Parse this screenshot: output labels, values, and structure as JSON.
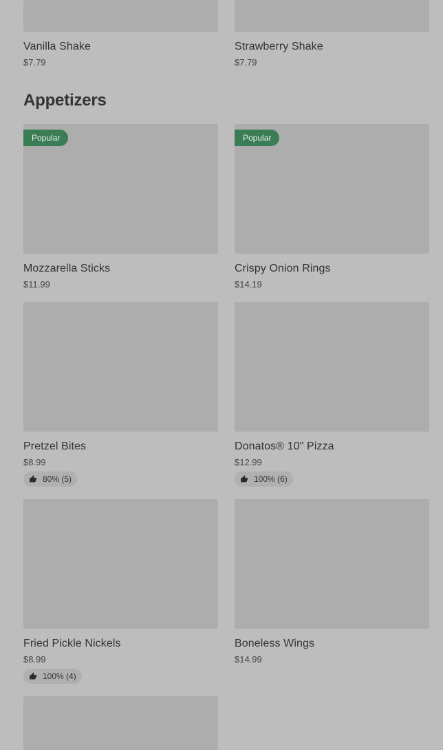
{
  "top_items": [
    {
      "name": "Vanilla Shake",
      "price": "$7.79"
    },
    {
      "name": "Strawberry Shake",
      "price": "$7.79"
    }
  ],
  "appetizers": {
    "title": "Appetizers",
    "items": [
      {
        "name": "Mozzarella Sticks",
        "price": "$11.99",
        "badge": "Popular"
      },
      {
        "name": "Crispy Onion Rings",
        "price": "$14.19",
        "badge": "Popular"
      },
      {
        "name": "Pretzel Bites",
        "price": "$8.99",
        "rating": "80% (5)"
      },
      {
        "name": "Donatos® 10\" Pizza",
        "price": "$12.99",
        "rating": "100% (6)"
      },
      {
        "name": "Fried Pickle Nickels",
        "price": "$8.99",
        "rating": "100% (4)"
      },
      {
        "name": "Boneless Wings",
        "price": "$14.99"
      }
    ]
  },
  "icons": {
    "rating": "thumbs-up-icon"
  },
  "colors": {
    "background": "#bdbdbd",
    "image_placeholder": "#adadad",
    "badge": "#3a7d54",
    "rating_pill": "#b0b0b0"
  }
}
